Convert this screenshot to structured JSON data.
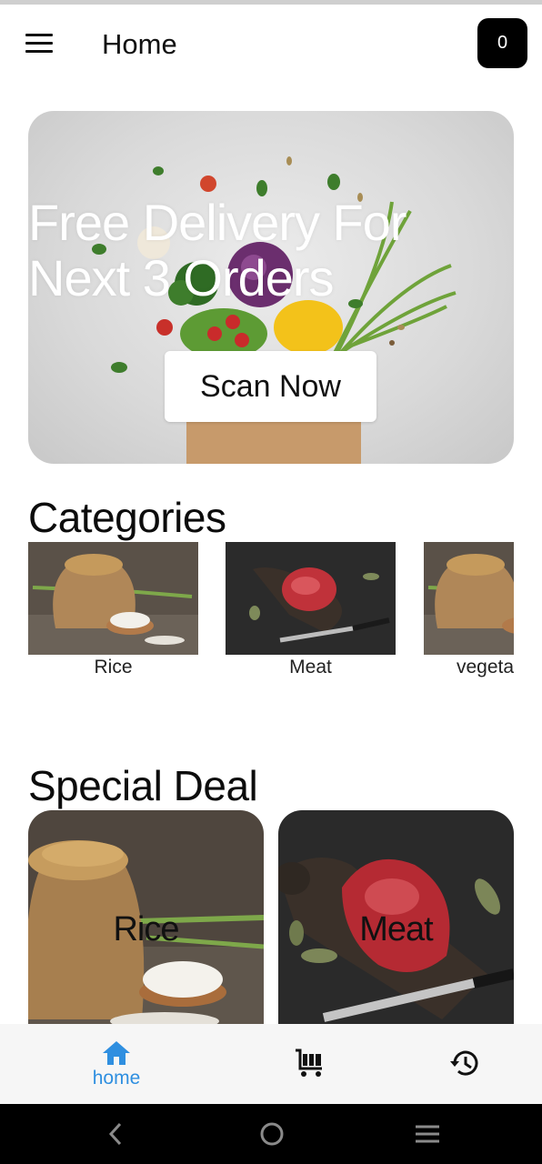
{
  "app_bar": {
    "title": "Home",
    "cart_count": "0",
    "menu_icon": "hamburger-menu-icon"
  },
  "banner": {
    "title_line1": "Free Delivery For",
    "title_line2": "Next 3 Orders",
    "button_label": "Scan Now"
  },
  "categories": {
    "heading": "Categories",
    "items": [
      {
        "label": "Rice",
        "image": "rice-sack"
      },
      {
        "label": "Meat",
        "image": "raw-steak"
      },
      {
        "label": "vegeta",
        "image": "rice-sack"
      }
    ]
  },
  "special_deal": {
    "heading": "Special Deal",
    "items": [
      {
        "label": "Rice",
        "image": "rice-sack"
      },
      {
        "label": "Meat",
        "image": "raw-steak"
      }
    ]
  },
  "bottom_nav": {
    "items": [
      {
        "label": "home",
        "icon": "home-icon",
        "active": true
      },
      {
        "label": "",
        "icon": "cart-icon",
        "active": false
      },
      {
        "label": "",
        "icon": "history-icon",
        "active": false
      }
    ],
    "active_color": "#2f8fe0"
  },
  "system_nav": {
    "icons": [
      "back-icon",
      "home-circle-icon",
      "recents-icon"
    ]
  }
}
